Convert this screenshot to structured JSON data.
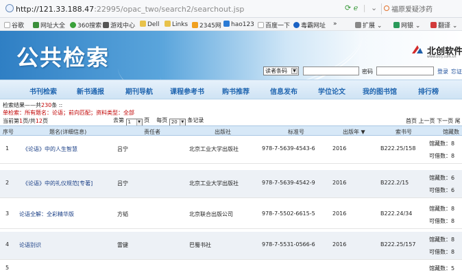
{
  "browser": {
    "url_prefix": "http://121.33.188.47",
    "url_rest": ":22995/opac_two/search2/searchout.jsp",
    "search_text": "福原爱疑涉药",
    "bookmarks": [
      "谷歌",
      "网址大全",
      "360搜索",
      "游戏中心",
      "Dell",
      "Links",
      "2345网",
      "hao123",
      "百度一下",
      "毒霸网址",
      "»",
      "扩展",
      "网银",
      "翻译"
    ]
  },
  "site": {
    "title": "公共检索",
    "logo_name": "北创软件",
    "logo_url": "www.bcrj.com.cn",
    "login_type": "读者条码",
    "pwd_label": "密码",
    "login_link": "登录",
    "forgot_link": "忘证"
  },
  "nav": [
    "书刊检索",
    "新书通报",
    "期刊导航",
    "课程参考书",
    "购书推荐",
    "信息发布",
    "学位论文",
    "我的图书馆",
    "排行榜"
  ],
  "results": {
    "summary_prefix": "检索结果——共",
    "total": "230",
    "summary_suffix": "条 ::",
    "condition": "单检索：所有题名：论语；前向匹配；资料类型：全部",
    "page_prefix": "当前第",
    "page_current": "1",
    "page_mid": "页/共",
    "page_total": "12",
    "page_suffix": "页",
    "goto_label": "去第",
    "goto_value": "1",
    "goto_suffix": "页",
    "per_page_label": "每页",
    "per_page_value": "20",
    "per_page_suffix": "条记录",
    "pager_links": "首页 上一页 下一页 尾"
  },
  "table": {
    "headers": {
      "no": "序号",
      "title": "题名(详细信息)",
      "author": "责任者",
      "publisher": "出版社",
      "isbn": "标准号",
      "year": "出版年",
      "callno": "索书号",
      "holdings": "馆藏数"
    },
    "sort_indicator": "▼",
    "rows": [
      {
        "no": "1",
        "title": "《论语》中的人生智慧",
        "author": "吕宁",
        "publisher": "北京工业大学出版社",
        "isbn": "978-7-5639-4543-6",
        "year": "2016",
        "callno": "B222.25/158",
        "held": "馆藏数：8",
        "avail": "可借数：8"
      },
      {
        "no": "2",
        "title": "《论语》中的礼仪规范[专著]",
        "author": "吕宁",
        "publisher": "北京工业大学出版社",
        "isbn": "978-7-5639-4542-9",
        "year": "2016",
        "callno": "B222.2/15",
        "held": "馆藏数：6",
        "avail": "可借数：6"
      },
      {
        "no": "3",
        "title": "论语全解：全彩精华版",
        "author": "方韬",
        "publisher": "北京联合出版公司",
        "isbn": "978-7-5502-6615-5",
        "year": "2016",
        "callno": "B222.24/34",
        "held": "馆藏数：8",
        "avail": "可借数：8"
      },
      {
        "no": "4",
        "title": "论语别识",
        "author": "雷键",
        "publisher": "巴蜀书社",
        "isbn": "978-7-5531-0566-6",
        "year": "2016",
        "callno": "B222.25/157",
        "held": "馆藏数：8",
        "avail": "可借数：8"
      },
      {
        "no": "5",
        "title": "",
        "author": "",
        "publisher": "",
        "isbn": "",
        "year": "",
        "callno": "",
        "held": "馆藏数：5",
        "avail": ""
      }
    ]
  },
  "colors": {
    "nav_text": "#2166b0",
    "alert": "#c00000",
    "header_bg": "#d7e8f7"
  }
}
